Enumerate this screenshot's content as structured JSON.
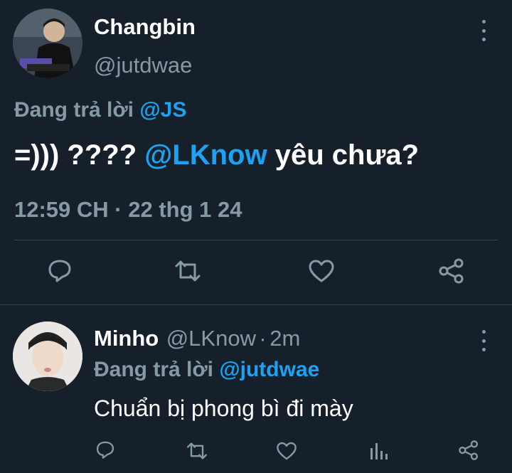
{
  "main_tweet": {
    "author_name": "Changbin",
    "author_handle": "@jutdwae",
    "reply_prefix": "Đang trả lời",
    "reply_mention": "@JS",
    "text_before": "=))) ????",
    "text_mention": "@LKnow",
    "text_after": "yêu chưa?",
    "timestamp": "12:59 CH · 22 thg 1 24"
  },
  "reply_tweet": {
    "author_name": "Minho",
    "author_handle": "@LKnow",
    "separator": "·",
    "time_ago": "2m",
    "reply_prefix": "Đang trả lời",
    "reply_mention": "@jutdwae",
    "text": "Chuẩn bị phong bì đi mày"
  },
  "colors": {
    "background": "#15202b",
    "accent": "#1da1f2",
    "muted": "#8899a6",
    "divider": "#38444d"
  },
  "icons": {
    "reply": "reply-icon",
    "retweet": "retweet-icon",
    "like": "heart-icon",
    "share": "share-icon",
    "analytics": "analytics-icon",
    "more": "more-vertical-icon"
  }
}
